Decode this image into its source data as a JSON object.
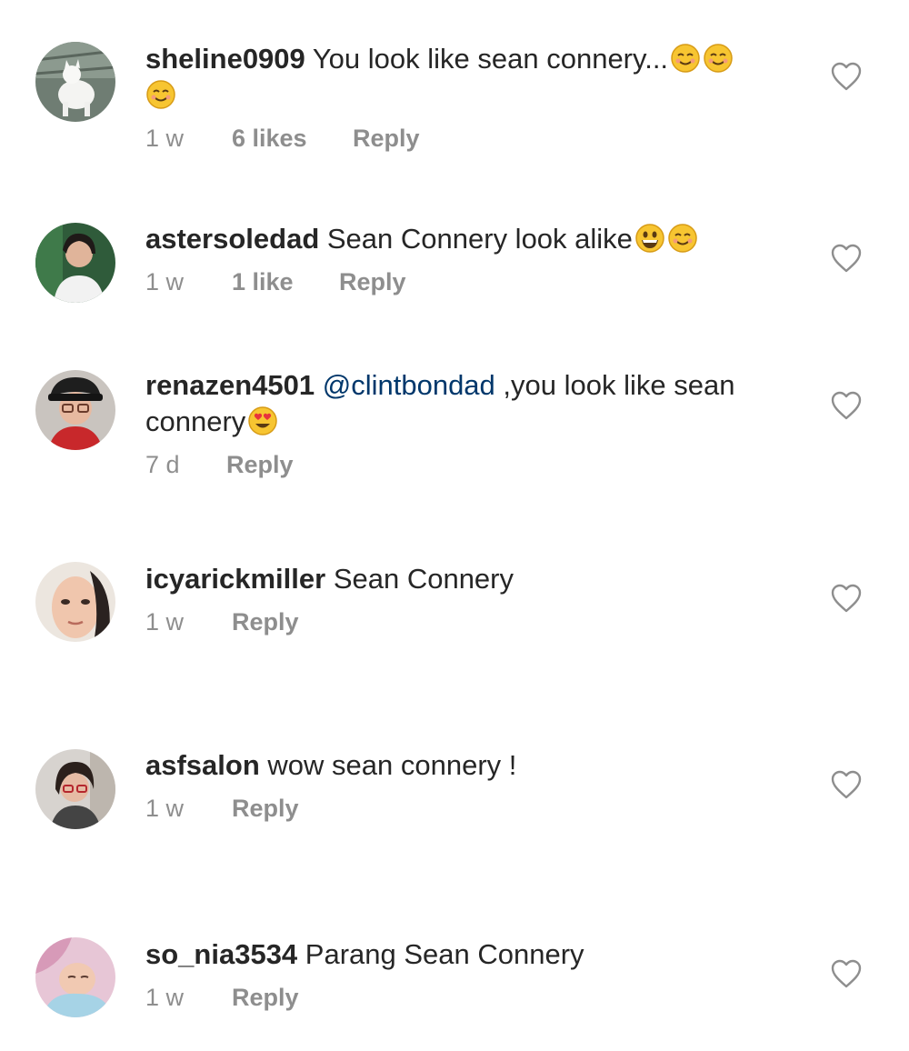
{
  "comments": [
    {
      "username": "sheline0909",
      "mention": "",
      "text": " You look like sean connery...",
      "emojis": [
        "smiling-face-icon",
        "smiling-face-icon",
        "smiling-face-icon"
      ],
      "time": "1 w",
      "likes": "6 likes",
      "reply": "Reply"
    },
    {
      "username": "astersoledad",
      "mention": "",
      "text": " Sean Connery look alike",
      "emojis": [
        "grinning-face-icon",
        "smiling-face-icon"
      ],
      "time": "1 w",
      "likes": "1 like",
      "reply": "Reply"
    },
    {
      "username": "renazen4501",
      "mention": "@clintbondad",
      "text": " ,you look like sean connery",
      "emojis": [
        "heart-eyes-face-icon"
      ],
      "time": "7 d",
      "likes": "",
      "reply": "Reply"
    },
    {
      "username": "icyarickmiller",
      "mention": "",
      "text": " Sean Connery",
      "emojis": [],
      "time": "1 w",
      "likes": "",
      "reply": "Reply"
    },
    {
      "username": "asfsalon",
      "mention": "",
      "text": " wow sean connery !",
      "emojis": [],
      "time": "1 w",
      "likes": "",
      "reply": "Reply"
    },
    {
      "username": "so_nia3534",
      "mention": "",
      "text": " Parang Sean Connery",
      "emojis": [],
      "time": "1 w",
      "likes": "",
      "reply": "Reply"
    }
  ],
  "icons": {
    "like": "heart-outline-icon"
  },
  "colors": {
    "text": "#262626",
    "meta": "#8e8e8e",
    "mention": "#00376b",
    "emoji": "#f7c531"
  }
}
